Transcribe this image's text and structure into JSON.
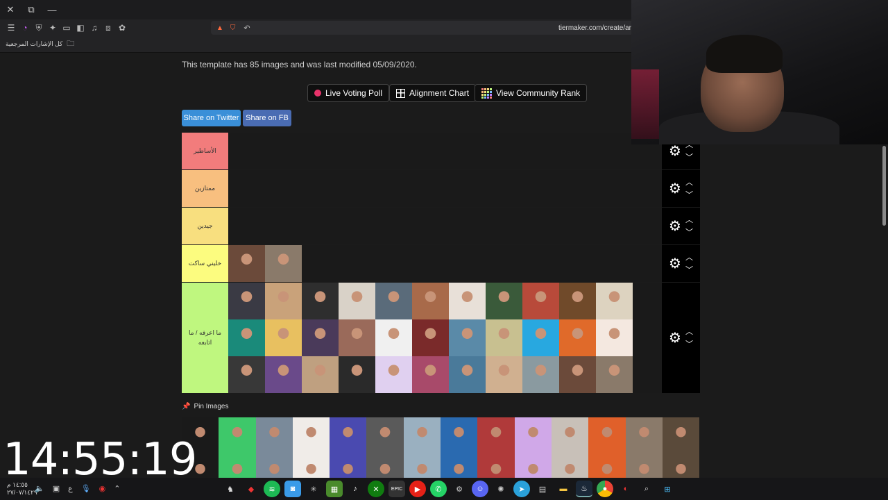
{
  "browser": {
    "url": "tiermaker.com/create/ar",
    "bookmarks_label": "كل الإشارات المرجعية",
    "title_controls": [
      "✕",
      "⧉",
      "—"
    ]
  },
  "page": {
    "template_info": "This template has 85 images and was last modified 05/09/2020.",
    "buttons": {
      "live_voting": "Live Voting Poll",
      "alignment": "Alignment Chart",
      "community_rank": "View Community Rank",
      "share_twitter": "Share on Twitter",
      "share_fb": "Share on FB"
    },
    "tiers": [
      {
        "label": "الأساطير",
        "color": "#f27c7c",
        "height": 54,
        "images": 0
      },
      {
        "label": "ممتازين",
        "color": "#f8bf7f",
        "height": 54,
        "images": 0
      },
      {
        "label": "جيدين",
        "color": "#f8df7f",
        "height": 54,
        "images": 0
      },
      {
        "label": "خليني ساكت",
        "color": "#fcfc7f",
        "height": 54,
        "images": 2
      },
      {
        "label": "ما اعرفه / ما اتابعه",
        "color": "#bff77f",
        "height": 160,
        "images": 33
      }
    ],
    "pin_label": "Pin Images",
    "pin_image_count": 28
  },
  "overlay": {
    "clock": "14:55:19"
  },
  "taskbar": {
    "time": "١٤:٥٥ م",
    "date": "٢٧/٠٧/١٤٢٩",
    "lang": "ع"
  },
  "colors": {
    "twitter": "#3a8fd8",
    "facebook": "#4a6cb3",
    "control_bg": "#000000"
  }
}
